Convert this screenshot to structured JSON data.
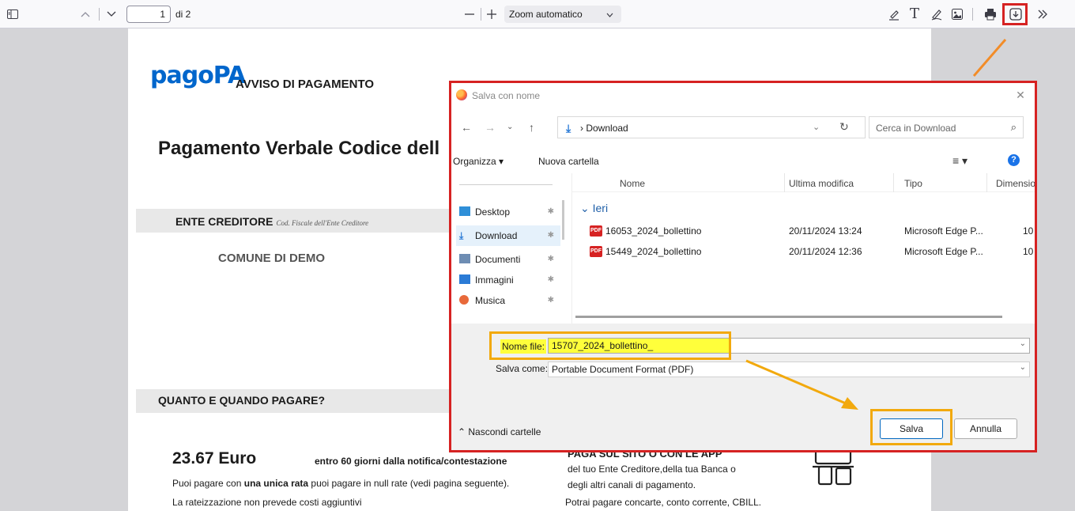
{
  "toolbar": {
    "page_number": "1",
    "page_of": "di 2",
    "zoom": "Zoom automatico",
    "icons": [
      "sidebar-toggle-icon",
      "previous-page-icon",
      "next-page-icon",
      "zoom-out-icon",
      "zoom-in-icon",
      "highlight-icon",
      "text-icon",
      "draw-icon",
      "image-icon",
      "print-icon",
      "save-icon",
      "more-tools-icon"
    ]
  },
  "document": {
    "logo_text": "pagoPA",
    "header": "AVVISO DI PAGAMENTO",
    "title": "Pagamento Verbale Codice dell",
    "ente_label": "ENTE CREDITORE",
    "ente_sub": "Cod. Fiscale dell'Ente Creditore",
    "comune": "COMUNE DI DEMO",
    "quanto": "QUANTO E QUANDO PAGARE?",
    "amount": "23.67 Euro",
    "deadline": "entro 60 giorni dalla notifica/contestazione",
    "line1_a": "Puoi pagare con ",
    "line1_b": "una unica rata",
    "line1_c": " puoi pagare in null rate (vedi pagina seguente).",
    "line2": "La rateizzazione non prevede costi aggiuntivi",
    "paga_heading": "PAGA SUL SITO O CON LE APP",
    "paga1": "del tuo Ente Creditore,della tua Banca o",
    "paga2": "degli altri canali di pagamento.",
    "paga3": "Potrai pagare concarte, conto corrente, CBILL."
  },
  "dialog": {
    "title": "Salva con nome",
    "address": "Download",
    "search_placeholder": "Cerca in Download",
    "organize": "Organizza ▾",
    "new_folder": "Nuova cartella",
    "columns": [
      "Nome",
      "Ultima modifica",
      "Tipo",
      "Dimensio"
    ],
    "group": "Ieri",
    "nav_items": [
      {
        "label": "Desktop",
        "icon": "desktop-icon",
        "color": "#2f8fd8"
      },
      {
        "label": "Download",
        "icon": "download-icon",
        "color": "#2b7bd6"
      },
      {
        "label": "Documenti",
        "icon": "documents-icon",
        "color": "#6e8db3"
      },
      {
        "label": "Immagini",
        "icon": "pictures-icon",
        "color": "#2b7bd6"
      },
      {
        "label": "Musica",
        "icon": "music-icon",
        "color": "#e8693a"
      }
    ],
    "files": [
      {
        "name": "16053_2024_bollettino",
        "modified": "20/11/2024 13:24",
        "type": "Microsoft Edge P...",
        "size": "10"
      },
      {
        "name": "15449_2024_bollettino",
        "modified": "20/11/2024 12:36",
        "type": "Microsoft Edge P...",
        "size": "10"
      }
    ],
    "file_name_label": "Nome file:",
    "file_name_value": "15707_2024_bollettino_",
    "save_as_label": "Salva come:",
    "save_as_value": "Portable Document Format (PDF)",
    "hide_folders": "Nascondi cartelle",
    "save_button": "Salva",
    "cancel_button": "Annulla"
  },
  "colors": {
    "highlight_red": "#d62222",
    "highlight_orange": "#f2a90d",
    "arrow_orange": "#f28c28",
    "field_yellow": "#ffff3b",
    "pagopa_blue": "#0066cc"
  }
}
